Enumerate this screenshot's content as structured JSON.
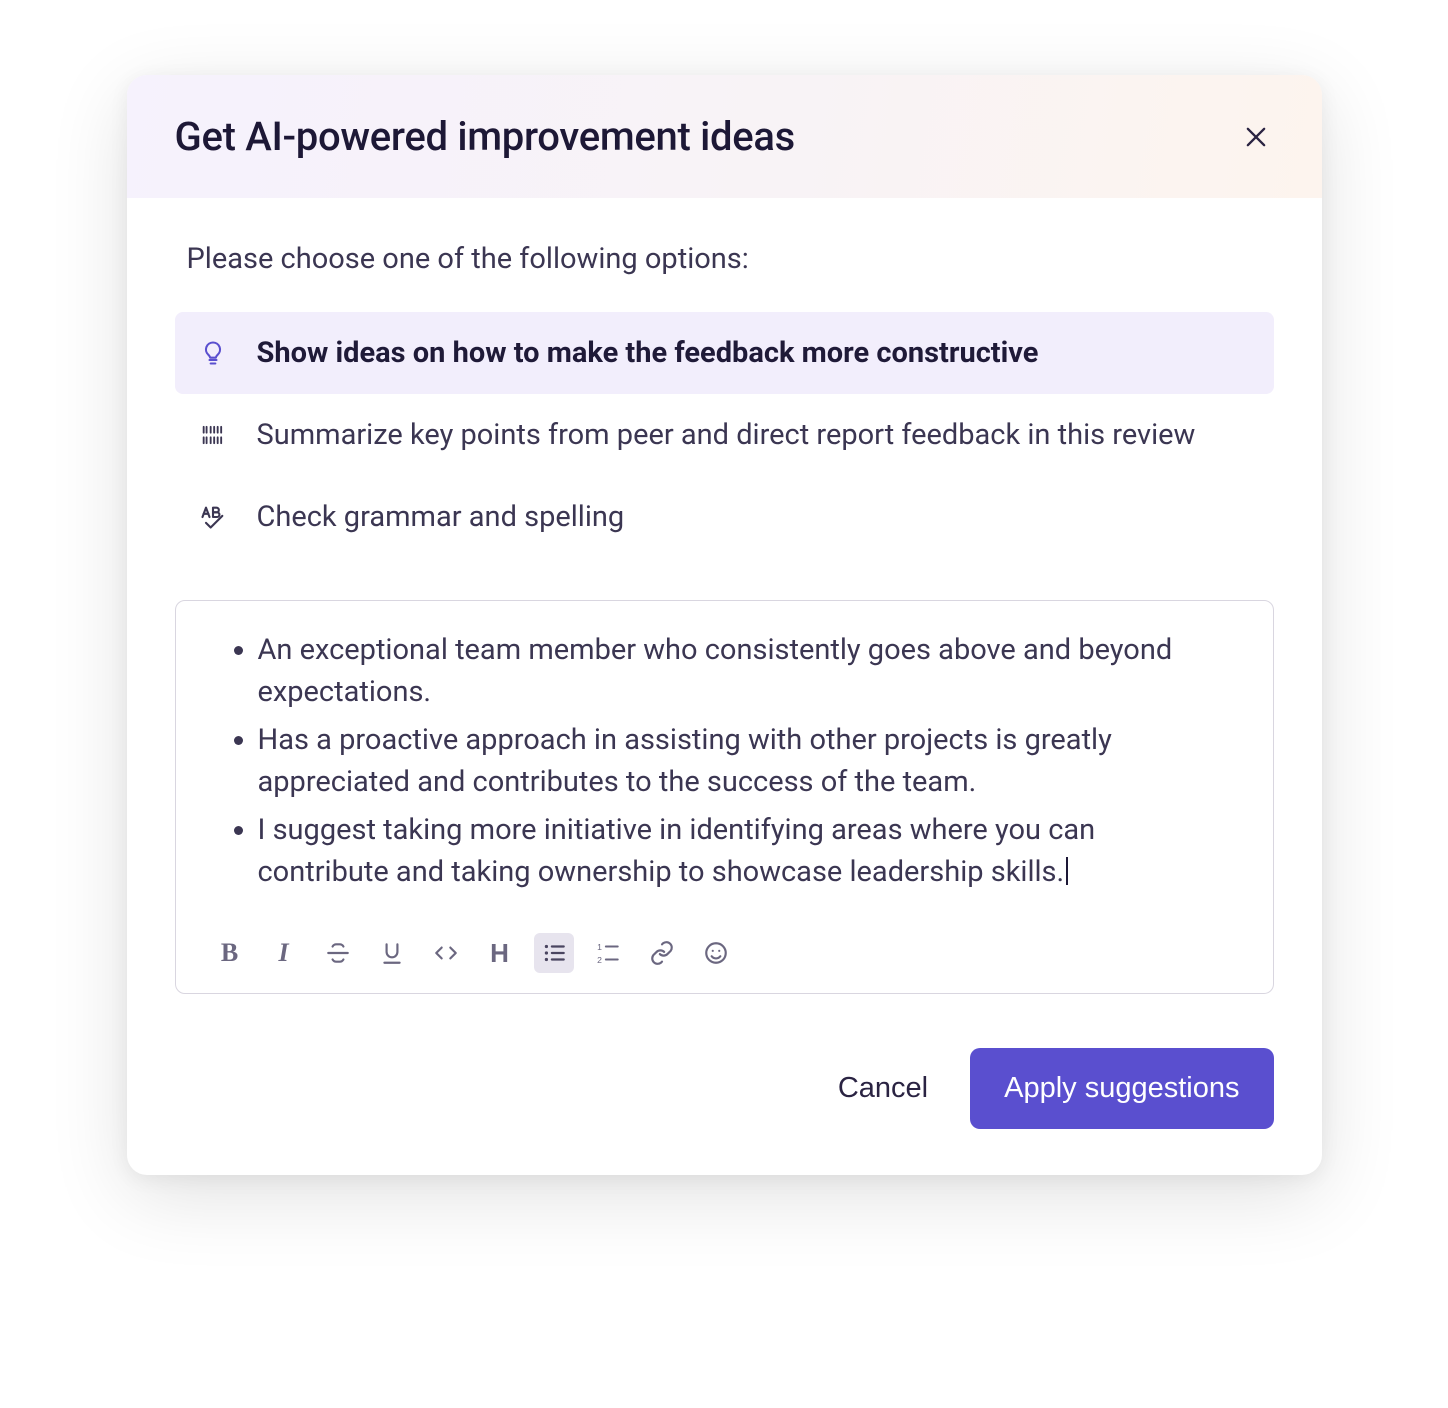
{
  "modal": {
    "title": "Get AI-powered improvement ideas",
    "prompt": "Please choose one of the following options:"
  },
  "options": [
    {
      "label": "Show ideas on how to make the feedback more constructive",
      "selected": true,
      "icon": "lightbulb-icon"
    },
    {
      "label": "Summarize key points from peer and direct report feedback in this review",
      "selected": false,
      "icon": "barcode-icon"
    },
    {
      "label": "Check grammar and spelling",
      "selected": false,
      "icon": "spellcheck-icon"
    }
  ],
  "editor": {
    "bullets": [
      "An exceptional team member who consistently goes above and beyond expectations.",
      "Has a proactive approach in assisting with other projects is greatly appreciated and contributes to the success of the team.",
      "I suggest taking more initiative in identifying areas where you can contribute and taking ownership to showcase leadership skills."
    ],
    "toolbar": {
      "bold": "B",
      "italic": "I",
      "heading": "H"
    }
  },
  "footer": {
    "cancel": "Cancel",
    "apply": "Apply suggestions"
  }
}
